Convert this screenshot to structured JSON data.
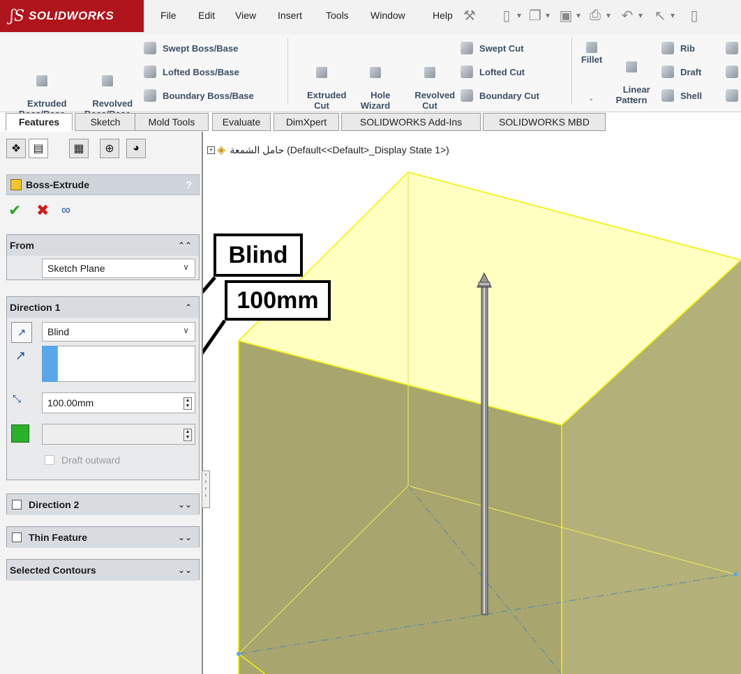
{
  "app": {
    "logo_ds": "ʃS",
    "brand": "SOLIDWORKS"
  },
  "menu": [
    "File",
    "Edit",
    "View",
    "Insert",
    "Tools",
    "Window",
    "Help"
  ],
  "ribbon": {
    "extruded_boss": "Extruded\nBoss/Base",
    "revolved_boss": "Revolved\nBoss/Base",
    "swept_boss": "Swept Boss/Base",
    "lofted_boss": "Lofted Boss/Base",
    "boundary_boss": "Boundary Boss/Base",
    "extruded_cut": "Extruded\nCut",
    "hole_wizard": "Hole\nWizard",
    "revolved_cut": "Revolved\nCut",
    "swept_cut": "Swept Cut",
    "lofted_cut": "Lofted Cut",
    "boundary_cut": "Boundary Cut",
    "fillet": "Fillet",
    "linear_pattern": "Linear\nPattern",
    "rib": "Rib",
    "draft": "Draft",
    "shell": "Shell"
  },
  "tabs": [
    "Features",
    "Sketch",
    "Mold Tools",
    "Evaluate",
    "DimXpert",
    "SOLIDWORKS Add-Ins",
    "SOLIDWORKS MBD"
  ],
  "tree": {
    "label": "حامل الشمعة  (Default<<Default>_Display State 1>)"
  },
  "panel": {
    "title": "Boss-Extrude",
    "help": "?",
    "from": {
      "header": "From",
      "value": "Sketch Plane"
    },
    "direction1": {
      "header": "Direction 1",
      "end_condition": "Blind",
      "depth": "100.00mm",
      "draft_outward": "Draft outward"
    },
    "direction2": {
      "header": "Direction 2"
    },
    "thin_feature": {
      "header": "Thin Feature"
    },
    "selected_contours": {
      "header": "Selected Contours"
    }
  },
  "callouts": {
    "type": "Blind",
    "depth": "100mm"
  },
  "colors": {
    "brand_red": "#b0141c",
    "face_fill": "#b4b07a",
    "edge_yellow": "#f2f000",
    "accent_blue": "#5aa6ea"
  }
}
